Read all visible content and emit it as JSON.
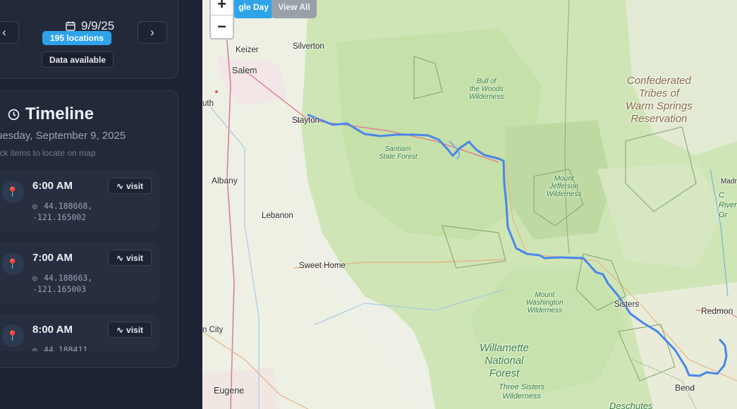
{
  "date_card": {
    "date": "9/9/25",
    "prev_icon": "chevron-left-icon",
    "next_icon": "chevron-right-icon",
    "prev_label": "‹",
    "next_label": "›",
    "locations_badge": "195 locations",
    "data_status": "Data available"
  },
  "timeline": {
    "title": "Timeline",
    "date_full": "uesday, September 9, 2025",
    "hint": "lick items to locate on map",
    "items": [
      {
        "time": "6:00 AM",
        "action": "visit",
        "lat": "44.188668,",
        "lon": "-121.165002"
      },
      {
        "time": "7:00 AM",
        "action": "visit",
        "lat": "44.188663,",
        "lon": "-121.165003"
      },
      {
        "time": "8:00 AM",
        "action": "visit",
        "lat": "44.188411",
        "lon": ""
      }
    ]
  },
  "map": {
    "zoom_in": "+",
    "zoom_out": "−",
    "mode_single": "gle Day",
    "mode_all": "View All",
    "route_color": "#4a86e8",
    "labels": {
      "keizer": "Keizer",
      "silverton": "Silverton",
      "salem": "Salem",
      "uth": "uth",
      "stayton": "Stayton",
      "albany": "Albany",
      "lebanon": "Lebanon",
      "sweet_home": "Sweet Home",
      "n_city": "n City",
      "eugene": "Eugene",
      "sisters": "Sisters",
      "redmond": "Redmon",
      "bend": "Bend",
      "madr": "Madr",
      "bull_woods_1": "Bull of",
      "bull_woods_2": "the Woods",
      "bull_woods_3": "Wilderness",
      "santiam_1": "Santiam",
      "santiam_2": "State Forest",
      "jefferson_1": "Mount",
      "jefferson_2": "Jefferson",
      "jefferson_3": "Wilderness",
      "washington_1": "Mount",
      "washington_2": "Washington",
      "washington_3": "Wilderness",
      "willamette_1": "Willamette",
      "willamette_2": "National",
      "willamette_3": "Forest",
      "three_sisters_1": "Three Sisters",
      "three_sisters_2": "Wilderness",
      "deschutes": "Deschutes",
      "warm_springs_1": "Confederated",
      "warm_springs_2": "Tribes of",
      "warm_springs_3": "Warm Springs",
      "warm_springs_4": "Reservation",
      "crooked_1": "C",
      "crooked_2": "River",
      "crooked_3": "Gr"
    }
  }
}
